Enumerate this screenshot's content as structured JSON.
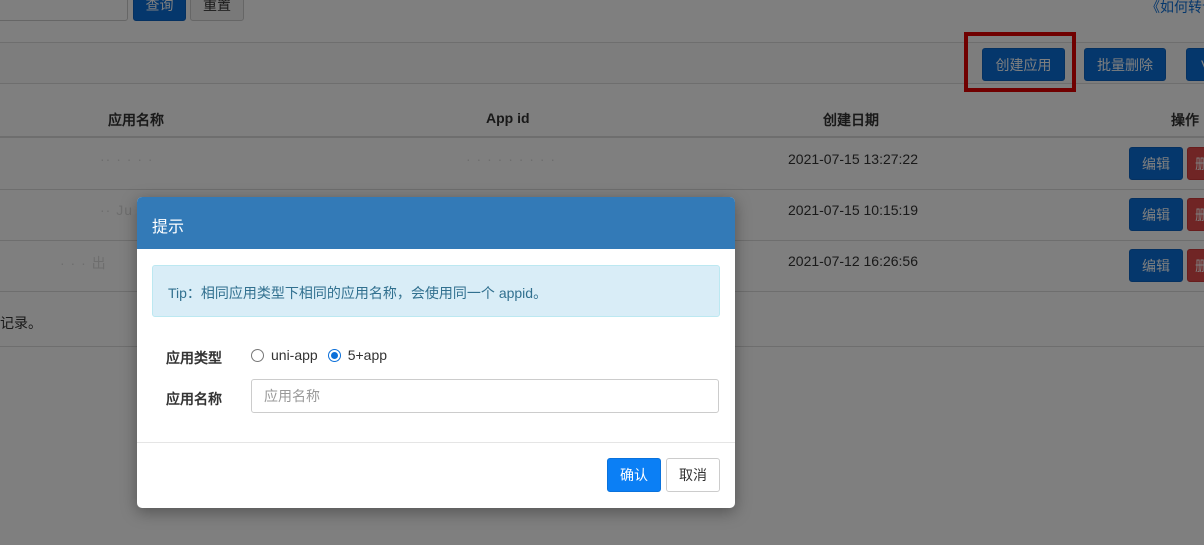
{
  "topbar": {
    "query_label": "查询",
    "reset_label": "重置",
    "help_link": "《如何转让"
  },
  "toolbar": {
    "create_label": "创建应用",
    "batch_delete_label": "批量删除",
    "more_label": "V"
  },
  "table": {
    "headers": [
      "应用名称",
      "App id",
      "创建日期",
      "操作"
    ],
    "rows": [
      {
        "name": "·· · · · ·",
        "appid": "· · · · · · · · ·",
        "created": "2021-07-15 13:27:22",
        "edit": "编辑",
        "delete": "删"
      },
      {
        "name": "·· Ju",
        "appid": "",
        "created": "2021-07-15 10:15:19",
        "edit": "编辑",
        "delete": "删"
      },
      {
        "name": "· · · 出",
        "appid": "",
        "created": "2021-07-12 16:26:56",
        "edit": "编辑",
        "delete": "删"
      }
    ],
    "footer_note": "记录。"
  },
  "modal": {
    "title": "提示",
    "tip": "Tip：相同应用类型下相同的应用名称，会使用同一个 appid。",
    "type_label": "应用类型",
    "options": [
      "uni-app",
      "5+app"
    ],
    "selected_option": "5+app",
    "name_label": "应用名称",
    "name_placeholder": "应用名称",
    "confirm_label": "确认",
    "cancel_label": "取消"
  },
  "colors": {
    "primary": "#0b6fd9",
    "modal_header": "#337ab7",
    "highlight": "#e00000",
    "danger": "#e04b4b"
  }
}
